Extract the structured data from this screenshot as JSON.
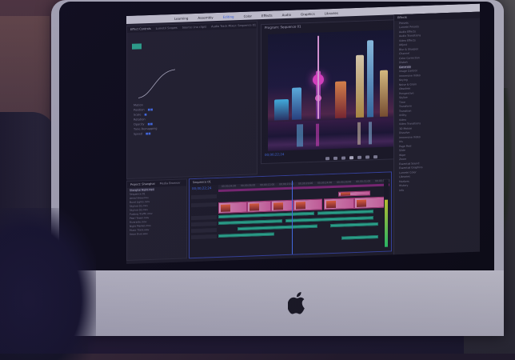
{
  "scene": {
    "brand_colors": {
      "accent": "#4a7bff",
      "clip_video": "#e46aa8",
      "clip_audio": "#2fbf98",
      "ui_bg": "#232329"
    }
  },
  "editor": {
    "menubar": {
      "items": [
        "Learning",
        "Assembly",
        "Editing",
        "Color",
        "Effects",
        "Audio",
        "Graphics",
        "Libraries"
      ],
      "active_index": 2
    },
    "effect_controls": {
      "tabs": [
        "Effect Controls",
        "Lumetri Scopes",
        "Source: (no clips)",
        "Audio Track Mixer: Sequence 01"
      ],
      "rows": [
        "Motion",
        "Position",
        "Scale",
        "Rotation",
        "Opacity",
        "Time Remapping",
        "Speed"
      ]
    },
    "program_monitor": {
      "title": "Program: Sequence 01",
      "timecode_left": "00;00;22;24",
      "timecode_right": "00;03;40;18"
    },
    "project_panel": {
      "title": "Effects",
      "items": [
        "Presets",
        "Lumetri Presets",
        "Audio Effects",
        "Audio Transitions",
        "Video Effects",
        "Adjust",
        "Blur & Sharpen",
        "Channel",
        "Color Correction",
        "Distort",
        "Generate",
        "Image Control",
        "Immersive Video",
        "Keying",
        "Noise & Grain",
        "Obsolete",
        "Perspective",
        "Stylize",
        "Time",
        "Transform",
        "Transition",
        "Utility",
        "Video",
        "Video Transitions",
        "3D Motion",
        "Dissolve",
        "Immersive Video",
        "Iris",
        "Page Peel",
        "Slide",
        "Wipe",
        "Zoom",
        "Essential Sound",
        "Essential Graphics",
        "Lumetri Color",
        "Libraries",
        "Markers",
        "History",
        "Info"
      ],
      "selected_index": 10
    },
    "source_panel": {
      "tabs": [
        "Project: Shanghai",
        "Media Browser"
      ],
      "rows": [
        "Shanghai Night.mp4",
        "Sequence 01",
        "Aerial View.mov",
        "Bund Lights.mov",
        "Skyline 01.mov",
        "Skyline 02.mov",
        "Pudong Traffic.mov",
        "Pearl Tower.mov",
        "Riverside.mov",
        "Night Market.mov",
        "Music Track.wav",
        "Voice Over.wav"
      ],
      "selected_index": 0
    },
    "timeline": {
      "title": "Sequence 01",
      "timecode": "00;00;22;24",
      "ruler_labels": [
        "00;00;04;00",
        "00;00;08;00",
        "00;00;12;00",
        "00;00;16;00",
        "00;00;20;00",
        "00;00;24;00",
        "00;00;28;00",
        "00;00;32;00",
        "00;00;36;00"
      ]
    }
  }
}
